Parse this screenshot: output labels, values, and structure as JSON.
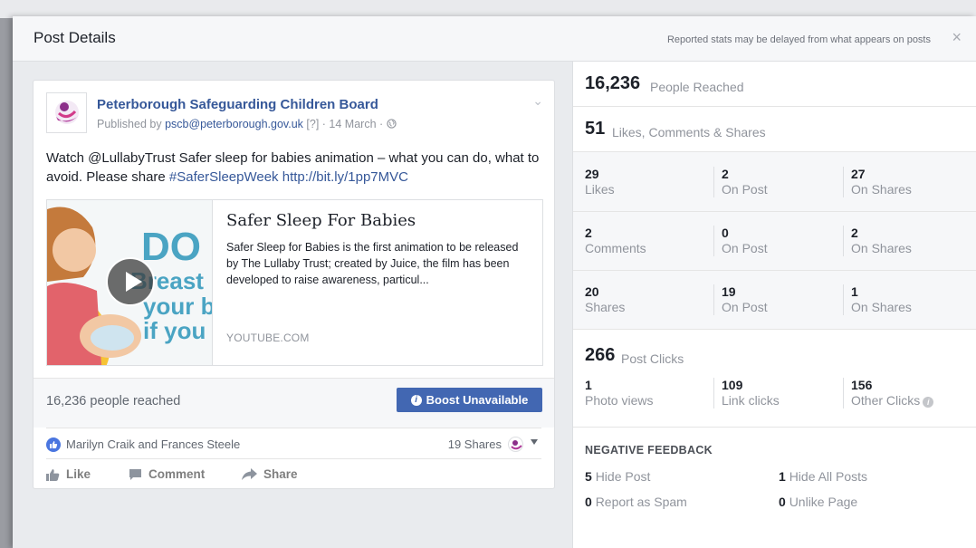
{
  "modal": {
    "title": "Post Details",
    "note": "Reported stats may be delayed from what appears on posts",
    "close_icon": "×"
  },
  "post": {
    "page_name": "Peterborough Safeguarding Children Board",
    "published_prefix": "Published by ",
    "publisher": "pscb@peterborough.gov.uk",
    "help_marker": "[?]",
    "date": "· 14 March ·",
    "text_part1": "Watch @LullabyTrust Safer sleep for babies animation – what you can do, what to avoid. Please share ",
    "hashtag": "#SaferSleepWeek",
    "link": "http://bit.ly/1pp7MVC",
    "preview": {
      "title": "Safer Sleep For Babies",
      "description": "Safer Sleep for Babies is the first animation to be released by The Lullaby Trust; created by Juice, the film has been developed to raise awareness, particul...",
      "domain": "YOUTUBE.COM",
      "thumb_text": [
        "DO",
        "Breast",
        "your ba",
        "if you c"
      ]
    },
    "reach_text": "16,236 people reached",
    "boost_label": "Boost Unavailable",
    "reaction_names": "Marilyn Craik and Frances Steele",
    "shares_count": "19 Shares",
    "actions": {
      "like": "Like",
      "comment": "Comment",
      "share": "Share"
    }
  },
  "insights": {
    "reached": {
      "value": "16,236",
      "label": "People Reached"
    },
    "engagement": {
      "value": "51",
      "label": "Likes, Comments & Shares"
    },
    "rows": [
      [
        {
          "num": "29",
          "lbl": "Likes"
        },
        {
          "num": "2",
          "lbl": "On Post"
        },
        {
          "num": "27",
          "lbl": "On Shares"
        }
      ],
      [
        {
          "num": "2",
          "lbl": "Comments"
        },
        {
          "num": "0",
          "lbl": "On Post"
        },
        {
          "num": "2",
          "lbl": "On Shares"
        }
      ],
      [
        {
          "num": "20",
          "lbl": "Shares"
        },
        {
          "num": "19",
          "lbl": "On Post"
        },
        {
          "num": "1",
          "lbl": "On Shares"
        }
      ]
    ],
    "clicks": {
      "value": "266",
      "label": "Post Clicks"
    },
    "click_cells": [
      {
        "num": "1",
        "lbl": "Photo views"
      },
      {
        "num": "109",
        "lbl": "Link clicks"
      },
      {
        "num": "156",
        "lbl": "Other Clicks"
      }
    ],
    "negative": {
      "title": "NEGATIVE FEEDBACK",
      "hide_post": {
        "num": "5",
        "lbl": "Hide Post"
      },
      "hide_all": {
        "num": "1",
        "lbl": "Hide All Posts"
      },
      "spam": {
        "num": "0",
        "lbl": "Report as Spam"
      },
      "unlike": {
        "num": "0",
        "lbl": "Unlike Page"
      }
    }
  },
  "colors": {
    "link_blue": "#365899",
    "boost_blue": "#4267b2",
    "muted_text": "#90949c",
    "thumb_teal": "#4aa4c3"
  }
}
